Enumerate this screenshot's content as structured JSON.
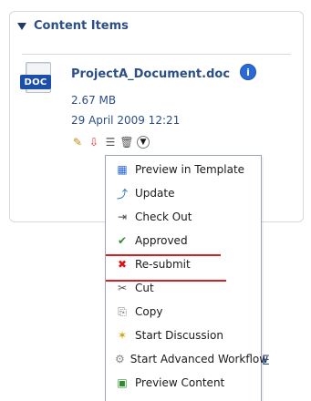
{
  "panel": {
    "title": "Content Items",
    "item": {
      "badge": "DOC",
      "name": "ProjectA_Document.doc",
      "size": "2.67 MB",
      "date": "29 April 2009 12:21"
    },
    "toolbar_icons": [
      "pencil-icon",
      "download-icon",
      "properties-icon",
      "trash-icon",
      "menu-toggle-icon"
    ]
  },
  "dropdown": {
    "items": [
      {
        "label": "Preview in Template",
        "icon": "preview-template-icon"
      },
      {
        "label": "Update",
        "icon": "update-icon"
      },
      {
        "label": "Check Out",
        "icon": "check-out-icon"
      },
      {
        "label": "Approved",
        "icon": "approved-icon"
      },
      {
        "label": "Re-submit",
        "icon": "resubmit-icon"
      },
      {
        "label": "Cut",
        "icon": "cut-icon"
      },
      {
        "label": "Copy",
        "icon": "copy-icon"
      },
      {
        "label": "Start Discussion",
        "icon": "start-discussion-icon"
      },
      {
        "label": "Start Advanced Workflow",
        "icon": "start-workflow-icon"
      },
      {
        "label": "Preview Content",
        "icon": "preview-content-icon"
      }
    ]
  },
  "cut_off_text": "E",
  "colors": {
    "title": "#2b4f86",
    "badge": "#1b4fa8",
    "redline": "#d91f1f"
  }
}
